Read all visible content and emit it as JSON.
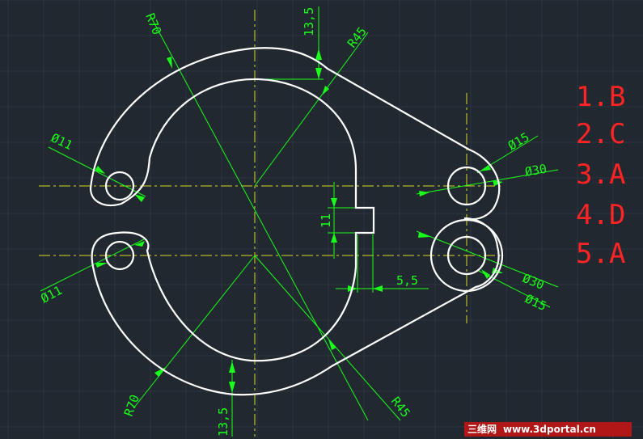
{
  "drawing": {
    "dimensions": {
      "r70_top": "R70",
      "r70_bottom": "R70",
      "r45_top": "R45",
      "r45_bottom": "R45",
      "top_offset": "13,5",
      "bottom_offset": "13,5",
      "slot_height": "11",
      "slot_depth": "5,5",
      "left_top_hole": "Ø11",
      "left_bottom_hole": "Ø11",
      "right_top_hole": "Ø15",
      "right_top_boss": "Ø30",
      "right_bottom_boss": "Ø30",
      "right_bottom_hole": "Ø15"
    }
  },
  "answers": [
    "1.B",
    "2.C",
    "3.A",
    "4.D",
    "5.A"
  ],
  "watermark": {
    "brand": "三维网",
    "url": "www.3dportal.cn"
  },
  "colors": {
    "background": "#212830",
    "grid": "#2c3540",
    "outline": "#ffffff",
    "centerline": "#d8d829",
    "dimension": "#19ff19",
    "answers": "#ff2323",
    "watermark_bg": "#b01818"
  }
}
